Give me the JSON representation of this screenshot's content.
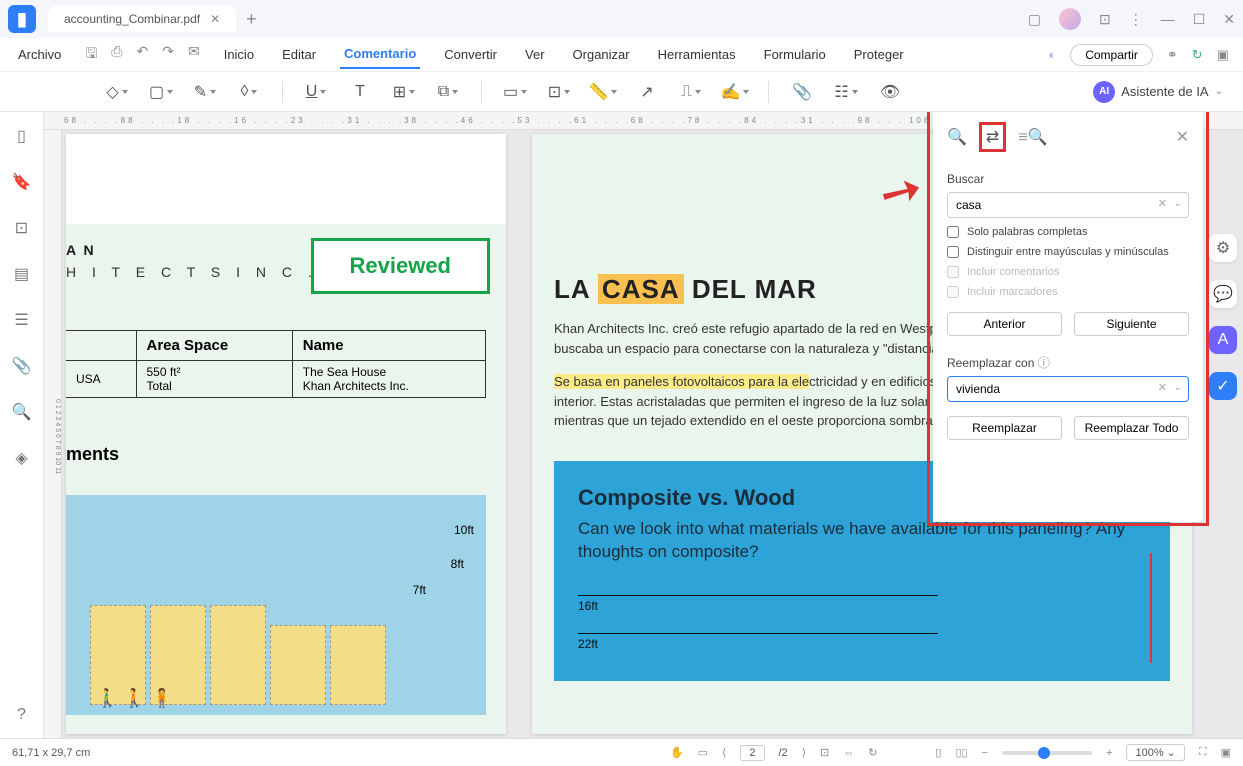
{
  "tab": {
    "title": "accounting_Combinar.pdf"
  },
  "menu": {
    "file": "Archivo",
    "items": [
      "Inicio",
      "Editar",
      "Comentario",
      "Convertir",
      "Ver",
      "Organizar",
      "Herramientas",
      "Formulario",
      "Proteger"
    ],
    "active": "Comentario",
    "share": "Compartir"
  },
  "ai": {
    "label": "Asistente de IA"
  },
  "ruler_top": "68 . . . .88 . . . .18 . . . .16 . . . .23 . . . .31 . . . .38 . . . .46 . . . .53 . . . .61 . . . .68 . . . .78 . . . .84 . . . .31 . . . .98 . . . 108 . . . .114",
  "ruler_left": "0  1  2  3  4  5  6  7  8  9  10  11",
  "page1": {
    "arch1": "A N",
    "arch2": "H I T E C T S   I N C .",
    "reviewed": "Reviewed",
    "th1": "Area Space",
    "th2": "Name",
    "c1a": "550 ft²",
    "c1b": "Total",
    "c2a": "The Sea House",
    "c2b": "Khan Architects Inc.",
    "col0": "USA",
    "ments": "ments",
    "h10": "10ft",
    "h8": "8ft",
    "h7": "7ft"
  },
  "page2": {
    "title_pre": "LA ",
    "title_hl": "CASA",
    "title_post": " DEL MAR",
    "para1": "Khan Architects Inc. creó este refugio apartado de la red en Westport, Washington, para una familia que buscaba un espacio para conectarse con la naturaleza y \"distanciarse del estrés\".",
    "para2a": "Se basa en paneles fotovoltaicos para la ele",
    "para2b": "ctricidad y en edificios pasivos para regular su temperatura interior. Estas acristaladas que permiten el ingreso de la luz solar para calentar interiores en invierno, mientras que un tejado extendido en el oeste proporciona sombra contra el calor solar durante el verano.",
    "sky_title": "Composite vs. Wood",
    "sky_q": "Can we look into what materials we have available for this paneling? Any thoughts on composite?",
    "s16": "16ft",
    "s22": "22ft"
  },
  "find": {
    "search_label": "Buscar",
    "search_value": "casa",
    "chk_whole": "Solo palabras completas",
    "chk_case": "Distinguir entre mayúsculas y minúsculas",
    "chk_comments": "Incluir comentarios",
    "chk_bookmarks": "Incluir marcadores",
    "btn_prev": "Anterior",
    "btn_next": "Siguiente",
    "replace_label": "Reemplazar con",
    "replace_value": "vivienda",
    "btn_replace": "Reemplazar",
    "btn_replace_all": "Reemplazar Todo"
  },
  "status": {
    "coords": "61,71 x 29,7 cm",
    "page": "2",
    "pages": "/2",
    "zoom": "100%"
  }
}
